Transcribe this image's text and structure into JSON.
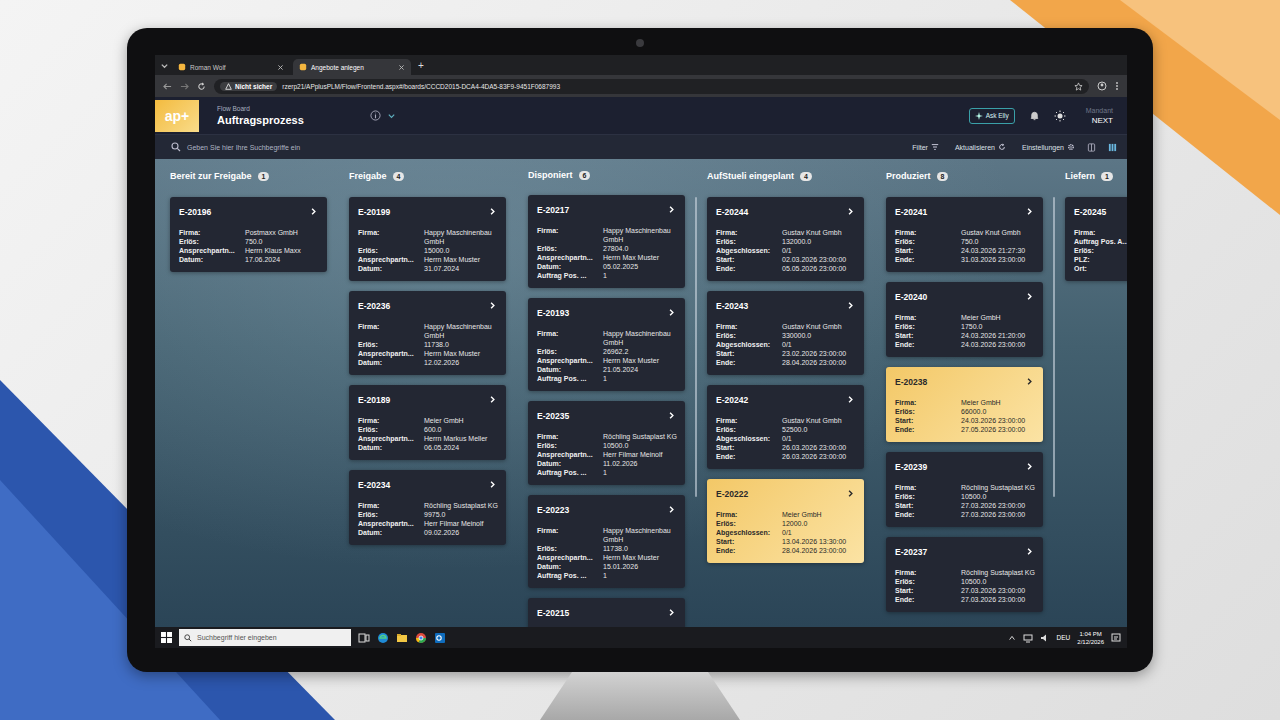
{
  "browser": {
    "tabs": [
      {
        "label": "Roman Wolf",
        "selected": false
      },
      {
        "label": "Angebote anlegen",
        "selected": true
      }
    ],
    "new_tab": "+",
    "security": "Nicht sicher",
    "url": "rzerp21/APplusPLM/Flow/Frontend.aspx#/boards/CCCD2015-DCA4-4DA5-83F9-9451F0687993"
  },
  "header": {
    "logo": "ap+",
    "subtitle": "Flow Board",
    "title": "Auftragsprozess",
    "ask": "Ask Elly",
    "tenant_label": "Mandant",
    "tenant": "NEXT"
  },
  "toolbar": {
    "search_placeholder": "Geben Sie hier Ihre Suchbegriffe ein",
    "buttons": [
      "Filter",
      "Aktualisieren",
      "Einstellungen"
    ]
  },
  "columns": [
    {
      "title": "Bereit zur Freigabe",
      "count": "1",
      "scrollbar": false,
      "cards": [
        {
          "id": "E-20196",
          "highlighted": false,
          "fields": [
            {
              "label": "Firma:",
              "value": "Postmaxx GmbH"
            },
            {
              "label": "Erlös:",
              "value": "750.0"
            },
            {
              "label": "Ansprechpartn...",
              "value": "Herrn Klaus Maxx"
            },
            {
              "label": "Datum:",
              "value": "17.06.2024"
            }
          ]
        }
      ]
    },
    {
      "title": "Freigabe",
      "count": "4",
      "scrollbar": false,
      "cards": [
        {
          "id": "E-20199",
          "highlighted": false,
          "fields": [
            {
              "label": "Firma:",
              "value": "Happy Maschinenbau GmbH"
            },
            {
              "label": "Erlös:",
              "value": "15000.0"
            },
            {
              "label": "Ansprechpartn...",
              "value": "Herrn Max Muster"
            },
            {
              "label": "Datum:",
              "value": "31.07.2024"
            }
          ]
        },
        {
          "id": "E-20236",
          "highlighted": false,
          "fields": [
            {
              "label": "Firma:",
              "value": "Happy Maschinenbau GmbH"
            },
            {
              "label": "Erlös:",
              "value": "11738.0"
            },
            {
              "label": "Ansprechpartn...",
              "value": "Herrn Max Muster"
            },
            {
              "label": "Datum:",
              "value": "12.02.2026"
            }
          ]
        },
        {
          "id": "E-20189",
          "highlighted": false,
          "fields": [
            {
              "label": "Firma:",
              "value": "Meier GmbH"
            },
            {
              "label": "Erlös:",
              "value": "600.0"
            },
            {
              "label": "Ansprechpartn...",
              "value": "Herrn Markus Meller"
            },
            {
              "label": "Datum:",
              "value": "06.05.2024"
            }
          ]
        },
        {
          "id": "E-20234",
          "highlighted": false,
          "fields": [
            {
              "label": "Firma:",
              "value": "Röchling Sustaplast KG"
            },
            {
              "label": "Erlös:",
              "value": "9975.0"
            },
            {
              "label": "Ansprechpartn...",
              "value": "Herr Filmar Meinolf"
            },
            {
              "label": "Datum:",
              "value": "09.02.2026"
            }
          ]
        }
      ]
    },
    {
      "title": "Disponiert",
      "count": "6",
      "scrollbar": true,
      "cards": [
        {
          "id": "E-20217",
          "highlighted": false,
          "fields": [
            {
              "label": "Firma:",
              "value": "Happy Maschinenbau GmbH"
            },
            {
              "label": "Erlös:",
              "value": "27804.0"
            },
            {
              "label": "Ansprechpartn...",
              "value": "Herrn Max Muster"
            },
            {
              "label": "Datum:",
              "value": "05.02.2025"
            },
            {
              "label": "Auftrag Pos. ...",
              "value": "1"
            }
          ]
        },
        {
          "id": "E-20193",
          "highlighted": false,
          "fields": [
            {
              "label": "Firma:",
              "value": "Happy Maschinenbau GmbH"
            },
            {
              "label": "Erlös:",
              "value": "26962.2"
            },
            {
              "label": "Ansprechpartn...",
              "value": "Herrn Max Muster"
            },
            {
              "label": "Datum:",
              "value": "21.05.2024"
            },
            {
              "label": "Auftrag Pos. ...",
              "value": "1"
            }
          ]
        },
        {
          "id": "E-20235",
          "highlighted": false,
          "fields": [
            {
              "label": "Firma:",
              "value": "Röchling Sustaplast KG"
            },
            {
              "label": "Erlös:",
              "value": "10500.0"
            },
            {
              "label": "Ansprechpartn...",
              "value": "Herr Filmar Meinolf"
            },
            {
              "label": "Datum:",
              "value": "11.02.2026"
            },
            {
              "label": "Auftrag Pos. ...",
              "value": "1"
            }
          ]
        },
        {
          "id": "E-20223",
          "highlighted": false,
          "fields": [
            {
              "label": "Firma:",
              "value": "Happy Maschinenbau GmbH"
            },
            {
              "label": "Erlös:",
              "value": "11738.0"
            },
            {
              "label": "Ansprechpartn...",
              "value": "Herrn Max Muster"
            },
            {
              "label": "Datum:",
              "value": "15.01.2026"
            },
            {
              "label": "Auftrag Pos. ...",
              "value": "1"
            }
          ]
        },
        {
          "id": "E-20215",
          "highlighted": false,
          "fields": []
        }
      ]
    },
    {
      "title": "AufStueli eingeplant",
      "count": "4",
      "scrollbar": false,
      "cards": [
        {
          "id": "E-20244",
          "highlighted": false,
          "fields": [
            {
              "label": "Firma:",
              "value": "Gustav Knut Gmbh"
            },
            {
              "label": "Erlös:",
              "value": "132000.0"
            },
            {
              "label": "Abgeschlossen:",
              "value": "0/1"
            },
            {
              "label": "Start:",
              "value": "02.03.2026 23:00:00"
            },
            {
              "label": "Ende:",
              "value": "05.05.2026 23:00:00"
            }
          ]
        },
        {
          "id": "E-20243",
          "highlighted": false,
          "fields": [
            {
              "label": "Firma:",
              "value": "Gustav Knut Gmbh"
            },
            {
              "label": "Erlös:",
              "value": "330000.0"
            },
            {
              "label": "Abgeschlossen:",
              "value": "0/1"
            },
            {
              "label": "Start:",
              "value": "23.02.2026 23:00:00"
            },
            {
              "label": "Ende:",
              "value": "28.04.2026 23:00:00"
            }
          ]
        },
        {
          "id": "E-20242",
          "highlighted": false,
          "fields": [
            {
              "label": "Firma:",
              "value": "Gustav Knut Gmbh"
            },
            {
              "label": "Erlös:",
              "value": "52500.0"
            },
            {
              "label": "Abgeschlossen:",
              "value": "0/1"
            },
            {
              "label": "Start:",
              "value": "26.03.2026 23:00:00"
            },
            {
              "label": "Ende:",
              "value": "26.03.2026 23:00:00"
            }
          ]
        },
        {
          "id": "E-20222",
          "highlighted": true,
          "fields": [
            {
              "label": "Firma:",
              "value": "Meier GmbH"
            },
            {
              "label": "Erlös:",
              "value": "12000.0"
            },
            {
              "label": "Abgeschlossen:",
              "value": "0/1"
            },
            {
              "label": "Start:",
              "value": "13.04.2026 13:30:00"
            },
            {
              "label": "Ende:",
              "value": "28.04.2026 23:00:00"
            }
          ]
        }
      ]
    },
    {
      "title": "Produziert",
      "count": "8",
      "scrollbar": true,
      "cards": [
        {
          "id": "E-20241",
          "highlighted": false,
          "fields": [
            {
              "label": "Firma:",
              "value": "Gustav Knut Gmbh"
            },
            {
              "label": "Erlös:",
              "value": "750.0"
            },
            {
              "label": "Start:",
              "value": "24.03.2026 21:27:30"
            },
            {
              "label": "Ende:",
              "value": "31.03.2026 23:00:00"
            }
          ]
        },
        {
          "id": "E-20240",
          "highlighted": false,
          "fields": [
            {
              "label": "Firma:",
              "value": "Meier GmbH"
            },
            {
              "label": "Erlös:",
              "value": "1750.0"
            },
            {
              "label": "Start:",
              "value": "24.03.2026 21:20:00"
            },
            {
              "label": "Ende:",
              "value": "24.03.2026 23:00:00"
            }
          ]
        },
        {
          "id": "E-20238",
          "highlighted": true,
          "fields": [
            {
              "label": "Firma:",
              "value": "Meier GmbH"
            },
            {
              "label": "Erlös:",
              "value": "66000.0"
            },
            {
              "label": "Start:",
              "value": "24.03.2026 23:00:00"
            },
            {
              "label": "Ende:",
              "value": "27.05.2026 23:00:00"
            }
          ]
        },
        {
          "id": "E-20239",
          "highlighted": false,
          "fields": [
            {
              "label": "Firma:",
              "value": "Röchling Sustaplast KG"
            },
            {
              "label": "Erlös:",
              "value": "10500.0"
            },
            {
              "label": "Start:",
              "value": "27.03.2026 23:00:00"
            },
            {
              "label": "Ende:",
              "value": "27.03.2026 23:00:00"
            }
          ]
        },
        {
          "id": "E-20237",
          "highlighted": false,
          "fields": [
            {
              "label": "Firma:",
              "value": "Röchling Sustaplast KG"
            },
            {
              "label": "Erlös:",
              "value": "10500.0"
            },
            {
              "label": "Start:",
              "value": "27.03.2026 23:00:00"
            },
            {
              "label": "Ende:",
              "value": "27.03.2026 23:00:00"
            }
          ]
        }
      ]
    },
    {
      "title": "Liefern",
      "count": "1",
      "scrollbar": false,
      "cards": [
        {
          "id": "E-20245",
          "highlighted": false,
          "fields": [
            {
              "label": "Firma:",
              "value": ""
            },
            {
              "label": "Auftrag Pos. A...",
              "value": ""
            },
            {
              "label": "Erlös:",
              "value": ""
            },
            {
              "label": "PLZ:",
              "value": ""
            },
            {
              "label": "Ort:",
              "value": ""
            }
          ]
        }
      ]
    }
  ],
  "taskbar": {
    "search_placeholder": "Suchbegriff hier eingeben",
    "language": "DEU",
    "time": "1:04 PM",
    "date": "2/12/2026"
  }
}
